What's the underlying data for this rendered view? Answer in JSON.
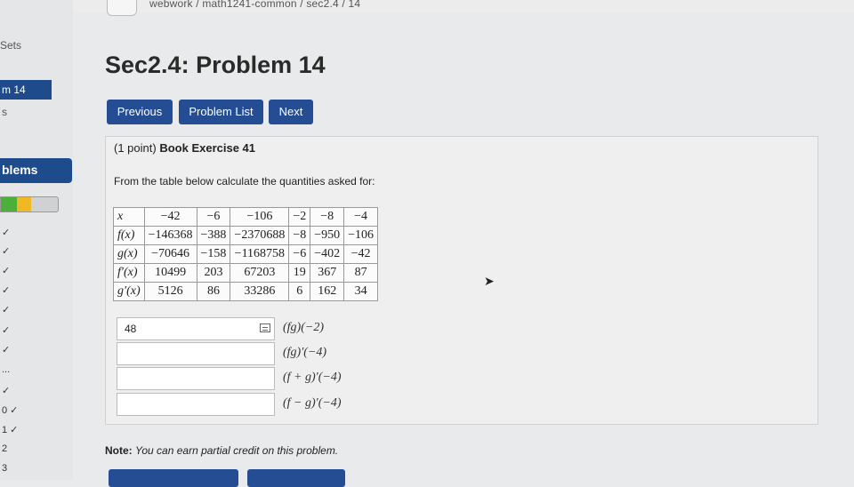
{
  "breadcrumb": "webwork / math1241-common / sec2.4 / 14",
  "sidebar": {
    "sets_label": "Sets",
    "active_item": "m 14",
    "item_s": "s",
    "problems_label": "blems",
    "status_marks": [
      "✓",
      "✓",
      "✓",
      "✓",
      "✓",
      "✓",
      "✓",
      "...",
      "✓",
      "0 ✓",
      "1 ✓",
      "2",
      "3"
    ]
  },
  "page_title": "Sec2.4: Problem 14",
  "nav": {
    "previous": "Previous",
    "problem_list": "Problem List",
    "next": "Next"
  },
  "problem": {
    "points": "(1 point)",
    "exercise": "Book Exercise 41",
    "instructions": "From the table below calculate the quantities asked for:"
  },
  "table": {
    "rows": [
      [
        "x",
        "−42",
        "−6",
        "−106",
        "−2",
        "−8",
        "−4"
      ],
      [
        "f(x)",
        "−146368",
        "−388",
        "−2370688",
        "−8",
        "−950",
        "−106"
      ],
      [
        "g(x)",
        "−70646",
        "−158",
        "−1168758",
        "−6",
        "−402",
        "−42"
      ],
      [
        "f′(x)",
        "10499",
        "203",
        "67203",
        "19",
        "367",
        "87"
      ],
      [
        "g′(x)",
        "5126",
        "86",
        "33286",
        "6",
        "162",
        "34"
      ]
    ]
  },
  "answers": [
    {
      "value": "48",
      "label": "(fg)(−2)"
    },
    {
      "value": "",
      "label": "(fg)′(−4)"
    },
    {
      "value": "",
      "label": "(f + g)′(−4)"
    },
    {
      "value": "",
      "label": "(f − g)′(−4)"
    }
  ],
  "note": {
    "label": "Note:",
    "text": "You can earn partial credit on this problem."
  }
}
